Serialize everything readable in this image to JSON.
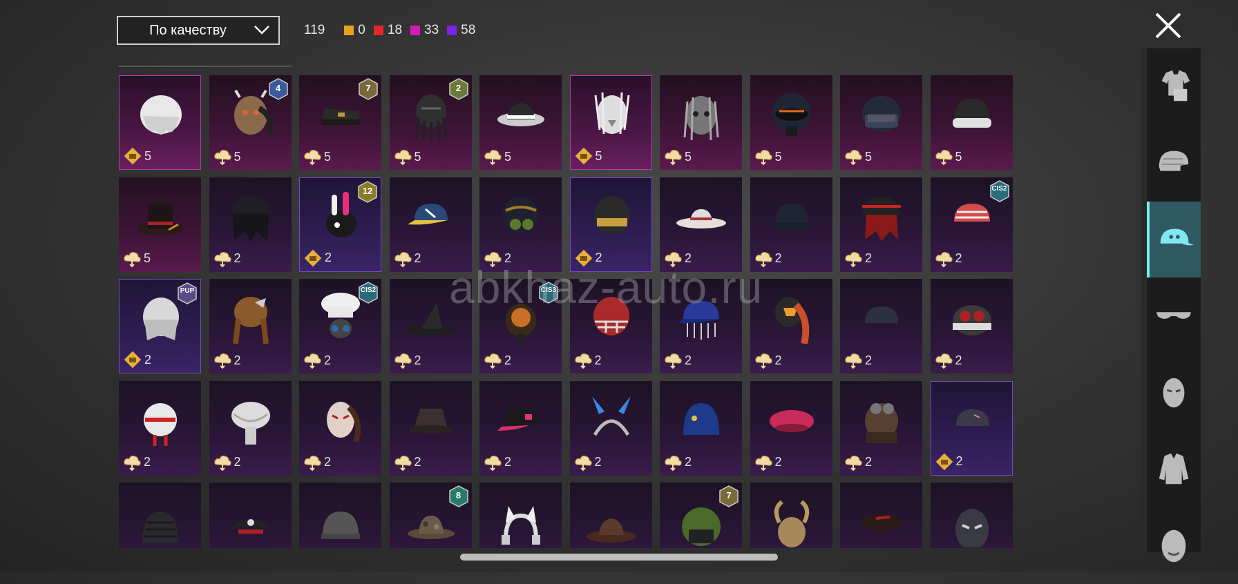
{
  "toolbar": {
    "sort_label": "По качеству",
    "total": "119",
    "counts": [
      {
        "color": "#e8a21f",
        "value": "0"
      },
      {
        "color": "#e3272b",
        "value": "18"
      },
      {
        "color": "#d21bb8",
        "value": "33"
      },
      {
        "color": "#7a24e0",
        "value": "58"
      }
    ]
  },
  "watermark": "abkhaz-auto.ru",
  "sidebar": {
    "tabs": [
      {
        "name": "outfit-tab",
        "icon": "shirt-icon"
      },
      {
        "name": "helmet-tab",
        "icon": "helmet-icon"
      },
      {
        "name": "hat-tab",
        "icon": "cap-icon",
        "active": true
      },
      {
        "name": "eyewear-tab",
        "icon": "glasses-icon"
      },
      {
        "name": "mask-tab",
        "icon": "mask-icon"
      },
      {
        "name": "jacket-tab",
        "icon": "jacket-icon"
      },
      {
        "name": "face-tab",
        "icon": "face-icon"
      }
    ]
  },
  "items": [
    {
      "t": "gold",
      "cur": "coin",
      "n": "5",
      "shape": "hair-white"
    },
    {
      "t": "pink",
      "cur": "cloud",
      "n": "5",
      "shape": "mask-oni",
      "badge": "4",
      "bc": "#3a5a9a"
    },
    {
      "t": "pink",
      "cur": "cloud",
      "n": "5",
      "shape": "cap-officer",
      "badge": "7",
      "bc": "#7a6a3a"
    },
    {
      "t": "pink",
      "cur": "cloud",
      "n": "5",
      "shape": "mask-predator",
      "badge": "2",
      "bc": "#6a7a3a"
    },
    {
      "t": "pink",
      "cur": "cloud",
      "n": "5",
      "shape": "fedora"
    },
    {
      "t": "gold",
      "cur": "coin",
      "n": "5",
      "shape": "lion"
    },
    {
      "t": "pink",
      "cur": "cloud",
      "n": "5",
      "shape": "mask-dread"
    },
    {
      "t": "pink",
      "cur": "cloud",
      "n": "5",
      "shape": "helmet-orange"
    },
    {
      "t": "pink",
      "cur": "cloud",
      "n": "5",
      "shape": "helmet-swat"
    },
    {
      "t": "pink",
      "cur": "cloud",
      "n": "5",
      "shape": "beanie-white"
    },
    {
      "t": "pink",
      "cur": "cloud",
      "n": "5",
      "shape": "tophat"
    },
    {
      "t": "",
      "cur": "cloud",
      "n": "2",
      "shape": "hair-black"
    },
    {
      "t": "violet",
      "cur": "coin",
      "n": "2",
      "shape": "bunny",
      "badge": "12",
      "bc": "#8a7a2a"
    },
    {
      "t": "",
      "cur": "cloud",
      "n": "2",
      "shape": "cap-blue"
    },
    {
      "t": "",
      "cur": "cloud",
      "n": "2",
      "shape": "gasmask"
    },
    {
      "t": "violet",
      "cur": "coin",
      "n": "2",
      "shape": "helmet-gold"
    },
    {
      "t": "",
      "cur": "cloud",
      "n": "2",
      "shape": "sunhat"
    },
    {
      "t": "",
      "cur": "cloud",
      "n": "2",
      "shape": "beanie-dark"
    },
    {
      "t": "",
      "cur": "cloud",
      "n": "2",
      "shape": "hair-red"
    },
    {
      "t": "",
      "cur": "cloud",
      "n": "2",
      "shape": "bandana",
      "badge": "CIS2",
      "bc": "#2a6a7a"
    },
    {
      "t": "violet",
      "cur": "coin",
      "n": "2",
      "shape": "hair-silver",
      "badge": "PUP",
      "bc": "#5a4a8a"
    },
    {
      "t": "",
      "cur": "cloud",
      "n": "2",
      "shape": "braids"
    },
    {
      "t": "",
      "cur": "cloud",
      "n": "2",
      "shape": "chef",
      "badge": "CIS2",
      "bc": "#2a6a7a"
    },
    {
      "t": "",
      "cur": "cloud",
      "n": "2",
      "shape": "witch"
    },
    {
      "t": "",
      "cur": "cloud",
      "n": "2",
      "shape": "gas-orange",
      "badge": "CIS3",
      "bc": "#2a6a7a"
    },
    {
      "t": "",
      "cur": "cloud",
      "n": "2",
      "shape": "football"
    },
    {
      "t": "",
      "cur": "cloud",
      "n": "2",
      "shape": "cricket"
    },
    {
      "t": "",
      "cur": "cloud",
      "n": "2",
      "shape": "hair-ponytail"
    },
    {
      "t": "",
      "cur": "cloud",
      "n": "2",
      "shape": "cap-grey"
    },
    {
      "t": "",
      "cur": "cloud",
      "n": "2",
      "shape": "goggles"
    },
    {
      "t": "",
      "cur": "cloud",
      "n": "2",
      "shape": "mask-white"
    },
    {
      "t": "",
      "cur": "cloud",
      "n": "2",
      "shape": "turban"
    },
    {
      "t": "",
      "cur": "cloud",
      "n": "2",
      "shape": "kabuki"
    },
    {
      "t": "",
      "cur": "cloud",
      "n": "2",
      "shape": "bucket-dark"
    },
    {
      "t": "",
      "cur": "cloud",
      "n": "2",
      "shape": "cap-pink"
    },
    {
      "t": "",
      "cur": "cloud",
      "n": "2",
      "shape": "bunny-band"
    },
    {
      "t": "",
      "cur": "cloud",
      "n": "2",
      "shape": "beanie-blue"
    },
    {
      "t": "",
      "cur": "cloud",
      "n": "2",
      "shape": "beret"
    },
    {
      "t": "",
      "cur": "cloud",
      "n": "2",
      "shape": "aviator"
    },
    {
      "t": "violet",
      "cur": "coin",
      "n": "2",
      "shape": "cap-dark"
    },
    {
      "t": "",
      "cur": "",
      "n": "",
      "shape": "beanie-knit"
    },
    {
      "t": "",
      "cur": "",
      "n": "",
      "shape": "pirate"
    },
    {
      "t": "",
      "cur": "",
      "n": "",
      "shape": "helmet-grey"
    },
    {
      "t": "",
      "cur": "",
      "n": "",
      "shape": "boonie",
      "badge": "8",
      "bc": "#2a7a6a"
    },
    {
      "t": "",
      "cur": "",
      "n": "",
      "shape": "catears"
    },
    {
      "t": "",
      "cur": "",
      "n": "",
      "shape": "cowboy"
    },
    {
      "t": "",
      "cur": "",
      "n": "",
      "shape": "helmet-green",
      "badge": "7",
      "bc": "#7a6a3a"
    },
    {
      "t": "",
      "cur": "",
      "n": "",
      "shape": "jester"
    },
    {
      "t": "",
      "cur": "",
      "n": "",
      "shape": "beret-dark"
    },
    {
      "t": "",
      "cur": "",
      "n": "",
      "shape": "luchador"
    }
  ]
}
